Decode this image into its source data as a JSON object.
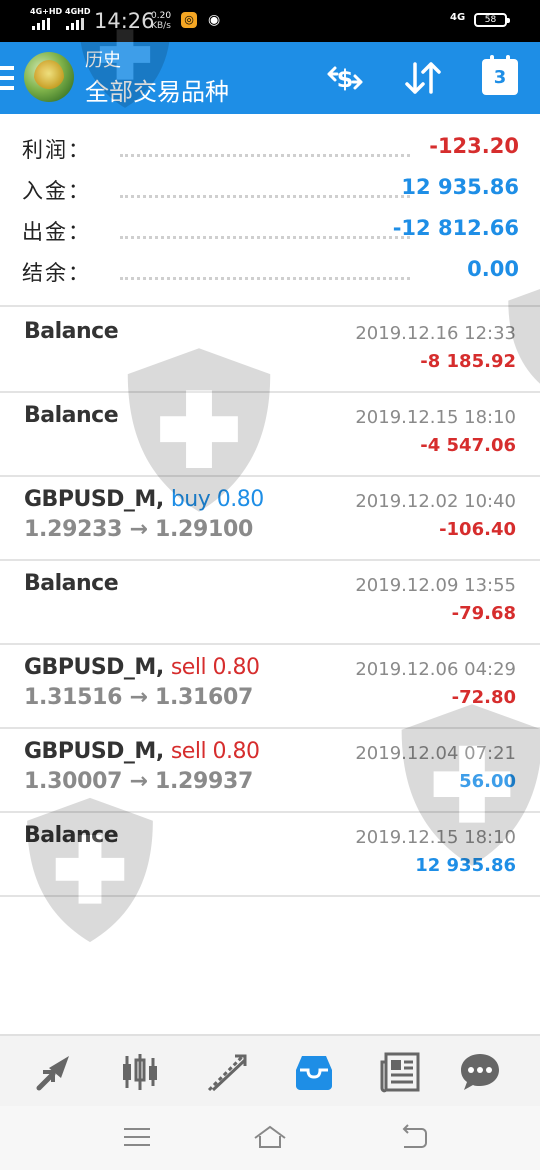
{
  "status_bar": {
    "net1": "4G+HD",
    "net2": "4GHD",
    "time": "14:26",
    "speed_value": "0.20",
    "speed_unit": "KB/s",
    "network_right": "4G",
    "battery": "58"
  },
  "header": {
    "title_small": "历史",
    "title_large": "全部交易品种",
    "calendar_day": "3"
  },
  "summary": [
    {
      "label": "利润：",
      "value": "-123.20",
      "color": "#d62d2d"
    },
    {
      "label": "入金：",
      "value": "12 935.86",
      "color": "#1e8ee6"
    },
    {
      "label": "出金：",
      "value": "-12 812.66",
      "color": "#1e8ee6"
    },
    {
      "label": "结余：",
      "value": "0.00",
      "color": "#1e8ee6"
    }
  ],
  "history": [
    {
      "title": "Balance",
      "direction": "",
      "time": "2019.12.16 12:33",
      "amount": "-8 185.92",
      "price": "",
      "amount_color": "#d62d2d"
    },
    {
      "title": "Balance",
      "direction": "",
      "time": "2019.12.15 18:10",
      "amount": "-4 547.06",
      "price": "",
      "amount_color": "#d62d2d"
    },
    {
      "title": "GBPUSD_M, ",
      "direction": "buy 0.80",
      "direction_color": "#1e8ee6",
      "time": "2019.12.02 10:40",
      "amount": "-106.40",
      "price": "1.29233 → 1.29100",
      "amount_color": "#d62d2d"
    },
    {
      "title": "Balance",
      "direction": "",
      "time": "2019.12.09 13:55",
      "amount": "-79.68",
      "price": "",
      "amount_color": "#d62d2d"
    },
    {
      "title": "GBPUSD_M, ",
      "direction": "sell 0.80",
      "direction_color": "#d62d2d",
      "time": "2019.12.06 04:29",
      "amount": "-72.80",
      "price": "1.31516 → 1.31607",
      "amount_color": "#d62d2d"
    },
    {
      "title": "GBPUSD_M, ",
      "direction": "sell 0.80",
      "direction_color": "#d62d2d",
      "time": "2019.12.04 07:21",
      "amount": "56.00",
      "price": "1.30007 → 1.29937",
      "amount_color": "#1e8ee6"
    },
    {
      "title": "Balance",
      "direction": "",
      "time": "2019.12.15 18:10",
      "amount": "12 935.86",
      "price": "",
      "amount_color": "#1e8ee6"
    }
  ],
  "toolbar": {
    "items": [
      "quotes-icon",
      "chart-icon",
      "trade-icon",
      "history-icon",
      "news-icon",
      "chat-icon"
    ],
    "active": "history-icon",
    "active_color": "#1e8ee6",
    "inactive_color": "#666666"
  },
  "colors": {
    "header": "#1e8ee6",
    "profit_negative": "#d62d2d",
    "profit_positive": "#1e8ee6"
  }
}
